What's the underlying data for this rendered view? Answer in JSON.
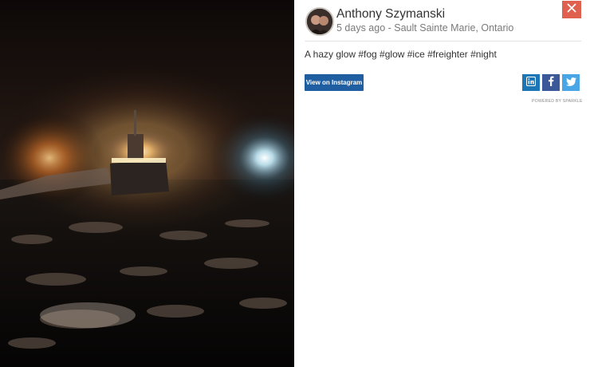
{
  "post": {
    "author_name": "Anthony Szymanski",
    "meta": "5 days ago - Sault Sainte Marie, Ontario",
    "caption": "A hazy glow #fog #glow #ice #freighter #night",
    "view_button_label": "View on Instagram",
    "powered_by": "POWERED BY SPARKLE"
  },
  "icons": {
    "close": "close-icon",
    "linkedin": "linkedin-icon",
    "facebook": "facebook-icon",
    "twitter": "twitter-icon"
  },
  "colors": {
    "close_button": "#e0604f",
    "view_button": "#1f5ea0",
    "linkedin": "#1c75b4",
    "facebook": "#3b5998",
    "twitter": "#49a6e6"
  }
}
